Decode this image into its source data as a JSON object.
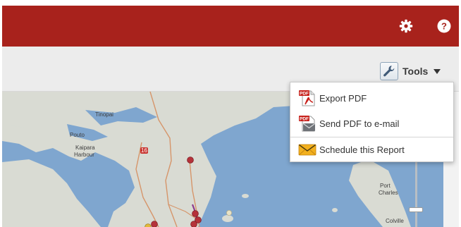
{
  "header": {
    "settings_icon": "gear-icon",
    "help_icon": "question-icon",
    "color": "#a8221c"
  },
  "toolbar": {
    "tools_label": "Tools",
    "tools_icon": "wrench-icon"
  },
  "tools_menu": {
    "items": [
      {
        "label": "Export PDF",
        "icon": "pdf-icon"
      },
      {
        "label": "Send PDF to e-mail",
        "icon": "pdf-email-icon"
      },
      {
        "label": "Schedule this Report",
        "icon": "envelope-icon"
      }
    ]
  },
  "map": {
    "labels": {
      "tinopai": "Tinopai",
      "pouto": "Pouto",
      "kaipara": "Kaipara",
      "harbour": "Harbour",
      "port": "Port",
      "charles": "Charles",
      "colville": "Colville",
      "route": "16"
    },
    "colors": {
      "sea": "#7fa6cf",
      "land": "#d9dbd3",
      "marker": "#b5323a"
    }
  }
}
